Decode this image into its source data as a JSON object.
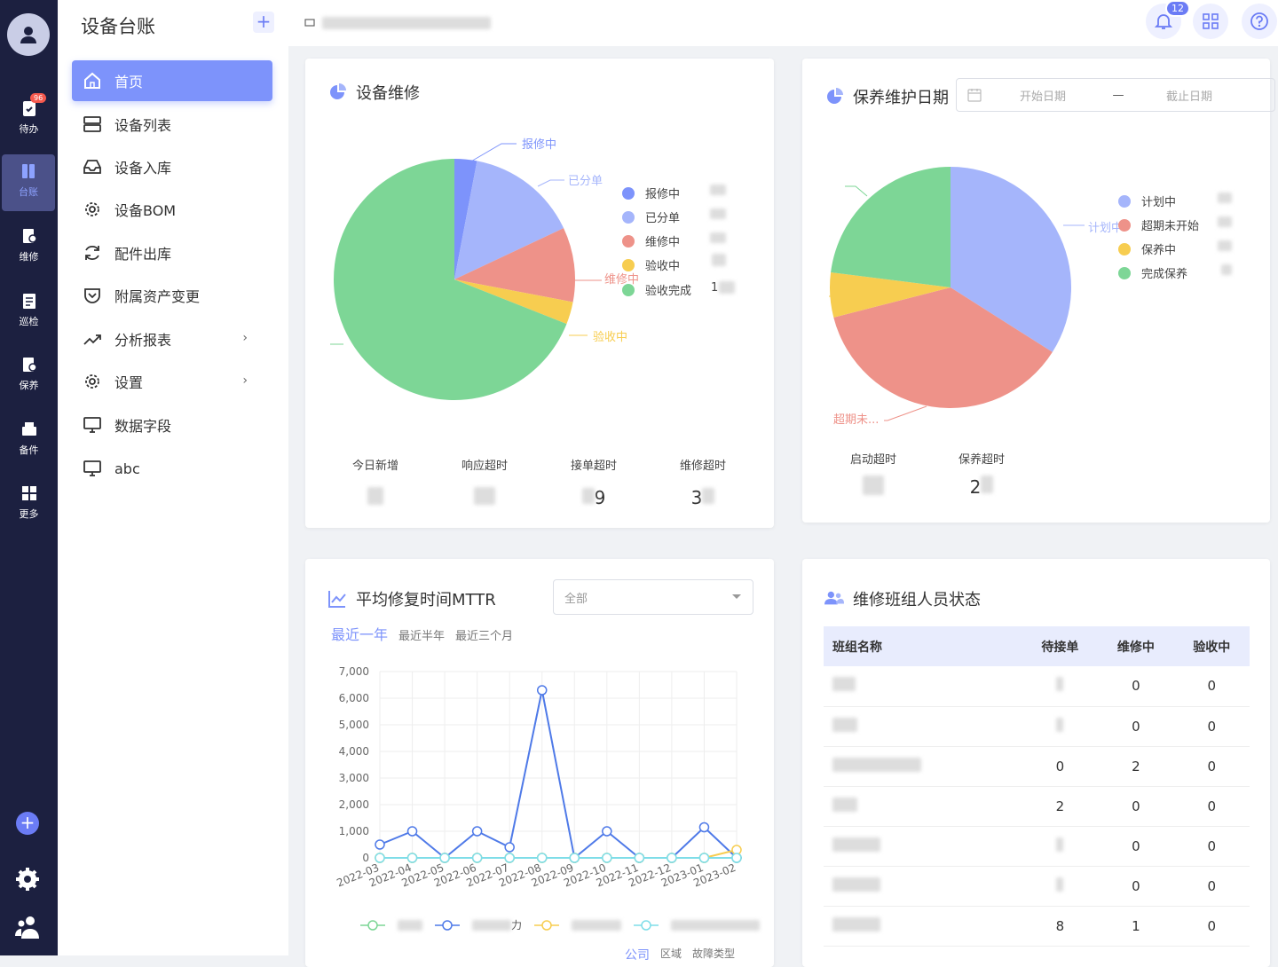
{
  "rail": {
    "items": [
      {
        "label": "待办",
        "badge": "96"
      },
      {
        "label": "台账"
      },
      {
        "label": "维修"
      },
      {
        "label": "巡检"
      },
      {
        "label": "保养"
      },
      {
        "label": "备件"
      },
      {
        "label": "更多"
      }
    ],
    "plus": "+"
  },
  "sidebar": {
    "title": "设备台账",
    "add": "+",
    "items": [
      {
        "label": "首页"
      },
      {
        "label": "设备列表"
      },
      {
        "label": "设备入库"
      },
      {
        "label": "设备BOM"
      },
      {
        "label": "配件出库"
      },
      {
        "label": "附属资产变更"
      },
      {
        "label": "分析报表"
      },
      {
        "label": "设置"
      },
      {
        "label": "数据字段"
      },
      {
        "label": "abc"
      }
    ],
    "arrow": "›"
  },
  "topbar": {
    "notification_count": "12"
  },
  "repair_card": {
    "title": "设备维修",
    "legend": [
      "报修中",
      "已分单",
      "维修中",
      "验收中",
      "验收完成"
    ],
    "legend_value_fragment": "1",
    "pie_labels": [
      "报修中",
      "已分单",
      "维修中",
      "验收中"
    ],
    "stats": [
      {
        "label": "今日新增",
        "value": ""
      },
      {
        "label": "响应超时",
        "value": ""
      },
      {
        "label": "接单超时",
        "value": "9"
      },
      {
        "label": "维修超时",
        "value": "3"
      }
    ]
  },
  "maintenance_card": {
    "title": "保养维护日期",
    "date_start_placeholder": "开始日期",
    "date_sep": "—",
    "date_end_placeholder": "截止日期",
    "legend": [
      "计划中",
      "超期未开始",
      "保养中",
      "完成保养"
    ],
    "pie_labels": [
      "计划中",
      "超期未..."
    ],
    "stats": [
      {
        "label": "启动超时",
        "value": ""
      },
      {
        "label": "保养超时",
        "value": "2"
      }
    ]
  },
  "mttr_card": {
    "title": "平均修复时间MTTR",
    "select_value": "全部",
    "tabs": [
      "最近一年",
      "最近半年",
      "最近三个月"
    ],
    "bottom_tabs": [
      "公司",
      "区域",
      "故障类型"
    ],
    "legend_fragment": "力"
  },
  "team_card": {
    "title": "维修班组人员状态",
    "columns": [
      "班组名称",
      "待接单",
      "维修中",
      "验收中"
    ],
    "rows": [
      {
        "pending": "",
        "repairing": "0",
        "accepting": "0"
      },
      {
        "pending": "",
        "repairing": "0",
        "accepting": "0"
      },
      {
        "pending": "0",
        "repairing": "2",
        "accepting": "0"
      },
      {
        "pending": "2",
        "repairing": "0",
        "accepting": "0"
      },
      {
        "pending": "",
        "repairing": "0",
        "accepting": "0"
      },
      {
        "pending": "",
        "repairing": "0",
        "accepting": "0"
      },
      {
        "pending": "8",
        "repairing": "1",
        "accepting": "0"
      }
    ]
  },
  "colors": {
    "accent": "#7d93fb",
    "pie_repair_reported": "#7d93fb",
    "pie_assigned": "#a5b5fb",
    "pie_repairing": "#ee9289",
    "pie_accepting": "#f7cd50",
    "pie_done": "#7dd696"
  },
  "chart_data": [
    {
      "type": "pie",
      "title": "设备维修",
      "categories": [
        "报修中",
        "已分单",
        "维修中",
        "验收中",
        "验收完成"
      ],
      "values": [
        3,
        15,
        10,
        3,
        69
      ]
    },
    {
      "type": "pie",
      "title": "保养维护日期",
      "categories": [
        "计划中",
        "超期未开始",
        "保养中",
        "完成保养"
      ],
      "values": [
        34,
        37,
        6,
        23
      ]
    },
    {
      "type": "line",
      "title": "平均修复时间MTTR",
      "x": [
        "2022-03",
        "2022-04",
        "2022-05",
        "2022-06",
        "2022-07",
        "2022-08",
        "2022-09",
        "2022-10",
        "2022-11",
        "2022-12",
        "2023-01",
        "2023-02"
      ],
      "ylim": [
        0,
        7000
      ],
      "yticks": [
        "0",
        "1,000",
        "2,000",
        "3,000",
        "4,000",
        "5,000",
        "6,000",
        "7,000"
      ],
      "series": [
        {
          "values": [
            0,
            0,
            0,
            0,
            0,
            0,
            0,
            0,
            0,
            0,
            0,
            0
          ]
        },
        {
          "values": [
            500,
            1000,
            0,
            1000,
            400,
            6300,
            0,
            1000,
            0,
            0,
            1150,
            0
          ]
        },
        {
          "values": [
            0,
            0,
            0,
            0,
            0,
            0,
            0,
            0,
            0,
            0,
            0,
            300
          ]
        },
        {
          "values": [
            0,
            0,
            0,
            0,
            0,
            0,
            0,
            0,
            0,
            0,
            0,
            0
          ]
        }
      ]
    }
  ]
}
